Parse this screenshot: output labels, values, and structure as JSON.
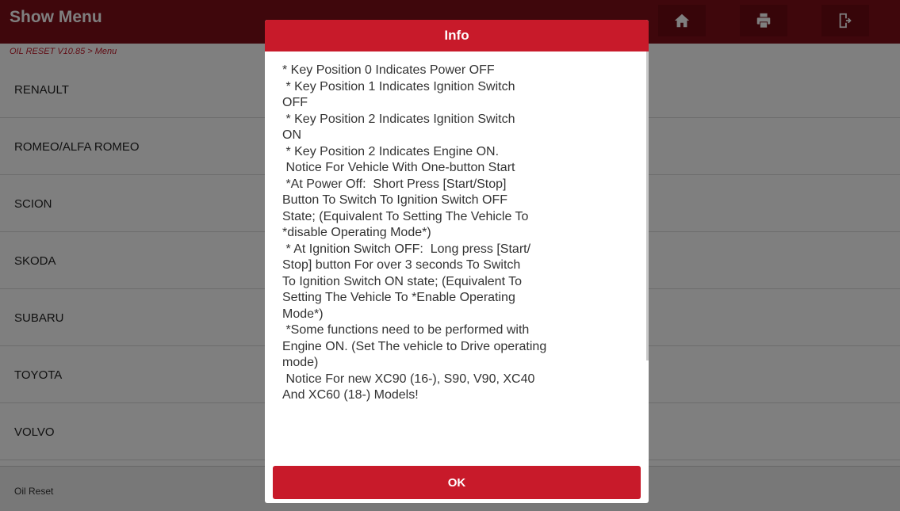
{
  "header": {
    "title": "Show Menu",
    "icons": [
      "home-icon",
      "printer-icon",
      "exit-icon"
    ]
  },
  "breadcrumb": "OIL RESET V10.85 > Menu",
  "list": {
    "items": [
      "RENAULT",
      "ROMEO/ALFA ROMEO",
      "SCION",
      "SKODA",
      "SUBARU",
      "TOYOTA",
      "VOLVO"
    ]
  },
  "footer": {
    "label": "Oil Reset"
  },
  "dialog": {
    "title": "Info",
    "ok_label": "OK",
    "lines": [
      "* Key Position 0 Indicates Power OFF",
      " * Key Position 1 Indicates Ignition Switch",
      "OFF",
      " * Key Position 2 Indicates Ignition Switch",
      "ON",
      " * Key Position 2 Indicates Engine ON.",
      " Notice For Vehicle With One-button Start",
      " *At Power Off:  Short Press [Start/Stop]",
      "Button To Switch To Ignition Switch OFF",
      "State; (Equivalent To Setting The Vehicle To",
      "*disable Operating Mode*)",
      " * At Ignition Switch OFF:  Long press [Start/",
      "Stop] button For over 3 seconds To Switch",
      "To Ignition Switch ON state; (Equivalent To",
      "Setting The Vehicle To *Enable Operating",
      "Mode*)",
      " *Some functions need to be performed with",
      "Engine ON. (Set The vehicle to Drive operating",
      "mode)",
      " Notice For new XC90 (16-), S90, V90, XC40",
      "And XC60 (18-) Models!"
    ]
  },
  "colors": {
    "topbar": "#7f0f18",
    "accent": "#c81a2a",
    "breadcrumb": "#c21b2a"
  }
}
